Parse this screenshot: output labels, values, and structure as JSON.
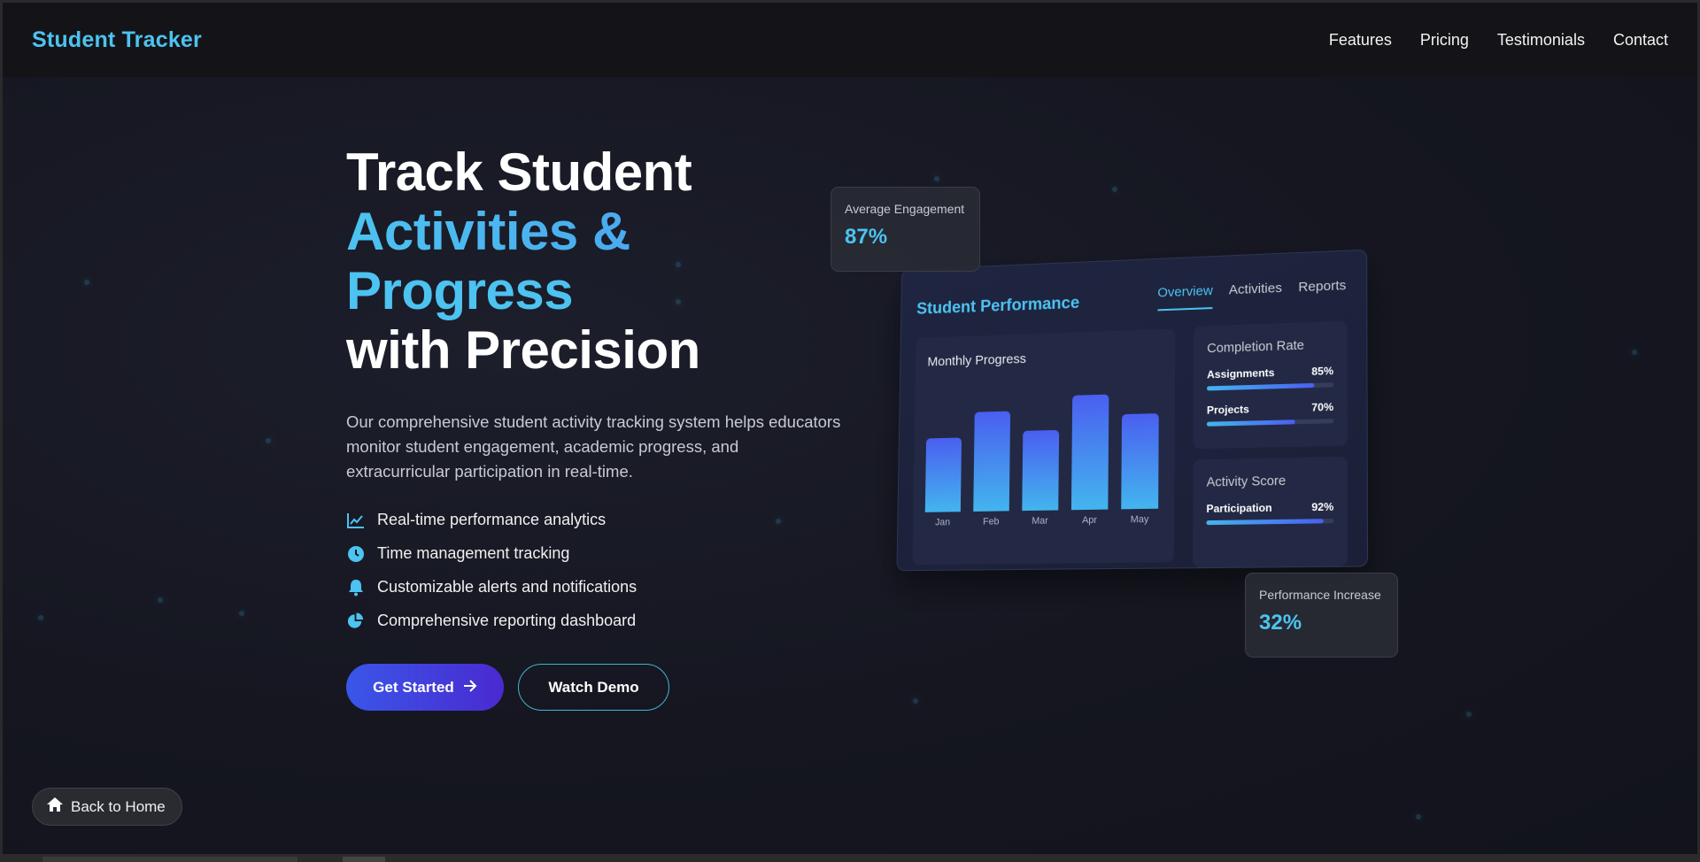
{
  "brand": "Student Tracker",
  "nav": [
    "Features",
    "Pricing",
    "Testimonials",
    "Contact"
  ],
  "hero": {
    "line1": "Track Student",
    "line2": "Activities &",
    "line3": "Progress",
    "line4": "with Precision",
    "description": "Our comprehensive student activity tracking system helps educators monitor student engagement, academic progress, and extracurricular participation in real-time.",
    "features": [
      {
        "icon": "chart-line-icon",
        "text": "Real-time performance analytics"
      },
      {
        "icon": "clock-icon",
        "text": "Time management tracking"
      },
      {
        "icon": "bell-icon",
        "text": "Customizable alerts and notifications"
      },
      {
        "icon": "pie-chart-icon",
        "text": "Comprehensive reporting dashboard"
      }
    ],
    "primary_button": "Get Started",
    "secondary_button": "Watch Demo"
  },
  "dashboard": {
    "title": "Student Performance",
    "tabs": [
      "Overview",
      "Activities",
      "Reports"
    ],
    "active_tab": "Overview",
    "monthly_title": "Monthly Progress",
    "completion": {
      "title": "Completion Rate",
      "items": [
        {
          "label": "Assignments",
          "value": "85%",
          "pct": 85
        },
        {
          "label": "Projects",
          "value": "70%",
          "pct": 70
        }
      ]
    },
    "activity": {
      "title": "Activity Score",
      "items": [
        {
          "label": "Participation",
          "value": "92%",
          "pct": 92
        }
      ]
    }
  },
  "chart_data": {
    "type": "bar",
    "categories": [
      "Jan",
      "Feb",
      "Mar",
      "Apr",
      "May"
    ],
    "values": [
      65,
      88,
      70,
      100,
      82
    ],
    "title": "Monthly Progress",
    "xlabel": "",
    "ylabel": ""
  },
  "stats": {
    "engagement_label": "Average Engagement",
    "engagement_value": "87%",
    "increase_label": "Performance Increase",
    "increase_value": "32%"
  },
  "back_button": "Back to Home",
  "colors": {
    "accent": "#4cc3f0",
    "primary_button": "#3a56e8",
    "background": "#151620"
  }
}
